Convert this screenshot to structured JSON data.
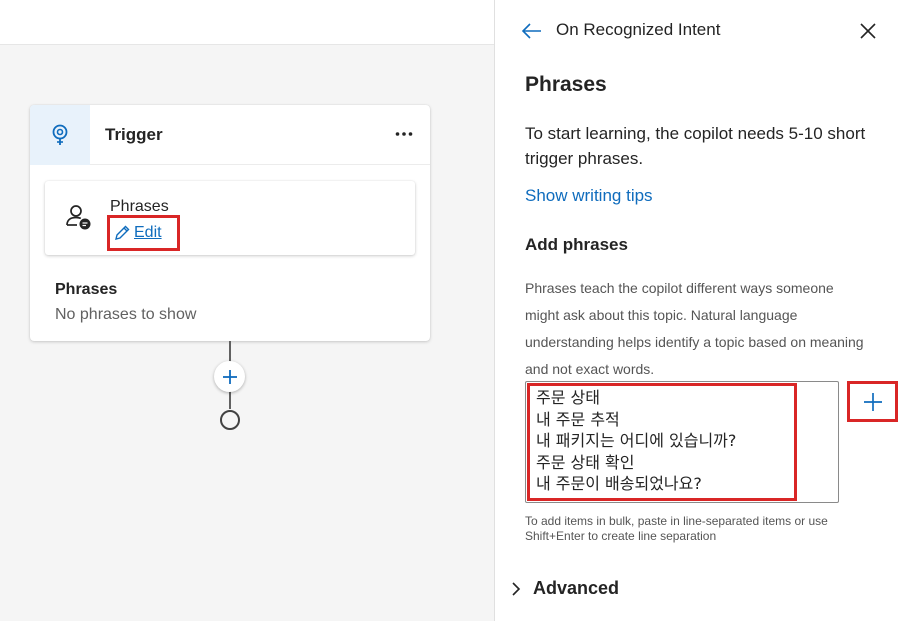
{
  "canvas": {
    "trigger_card": {
      "title": "Trigger",
      "more_label": "...",
      "phrases_card": {
        "title": "Phrases",
        "edit_label": "Edit"
      },
      "summary": {
        "title": "Phrases",
        "empty_text": "No phrases to show"
      }
    },
    "add_node_label": "+"
  },
  "panel": {
    "breadcrumb": "On Recognized Intent",
    "title": "Phrases",
    "description": "To start learning, the copilot needs 5-10 short trigger phrases.",
    "tips_link": "Show writing tips",
    "add_section": {
      "title": "Add phrases",
      "help": "Phrases teach the copilot different ways someone might ask about this topic. Natural language understanding helps identify a topic based on meaning and not exact words.",
      "phrases": [
        "주문 상태",
        "내 주문 추적",
        "내 패키지는 어디에 있습니까?",
        "주문 상태 확인",
        "내 주문이 배송되었나요?"
      ],
      "bulk_hint": "To add items in bulk, paste in line-separated items or use Shift+Enter to create line separation"
    },
    "advanced_label": "Advanced"
  },
  "colors": {
    "accent": "#0f6cbd",
    "highlight": "#d92626",
    "icon_bg": "#e8f2fb"
  },
  "icons": {
    "trigger": "lightbulb-icon",
    "more": "more-horizontal-icon",
    "person": "person-chat-icon",
    "edit": "pencil-icon",
    "back": "arrow-left-icon",
    "close": "close-icon",
    "add": "plus-icon",
    "advanced": "chevron-right-icon"
  }
}
